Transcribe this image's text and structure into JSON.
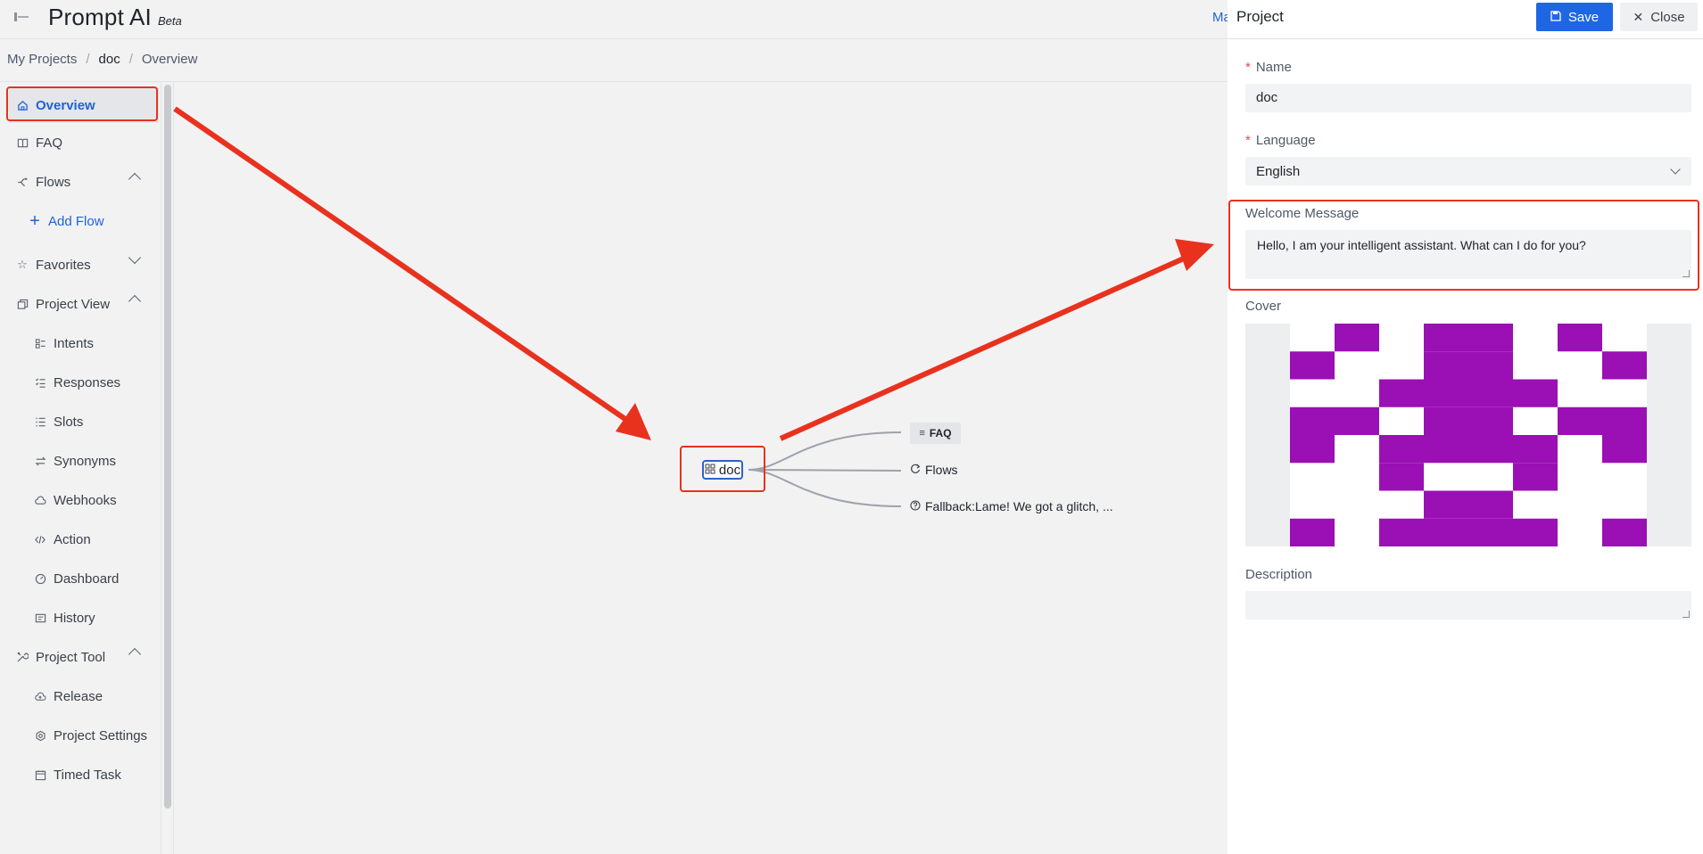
{
  "header": {
    "app_title": "Prompt AI",
    "app_badge": "Beta",
    "top_link": "Ma"
  },
  "breadcrumb": {
    "items": [
      "My Projects",
      "doc",
      "Overview"
    ],
    "separator": "/"
  },
  "sidebar": {
    "items": [
      {
        "label": "Overview",
        "icon": "home-icon",
        "active": true
      },
      {
        "label": "FAQ",
        "icon": "book-icon"
      },
      {
        "label": "Flows",
        "icon": "flow-icon",
        "expanded": true
      },
      {
        "label": "Add Flow",
        "icon": "plus-icon"
      },
      {
        "label": "Favorites",
        "icon": "star-icon",
        "expanded": false
      },
      {
        "label": "Project View",
        "icon": "project-view-icon",
        "expanded": true
      },
      {
        "label": "Intents",
        "icon": "intents-icon"
      },
      {
        "label": "Responses",
        "icon": "responses-icon"
      },
      {
        "label": "Slots",
        "icon": "slots-icon"
      },
      {
        "label": "Synonyms",
        "icon": "synonyms-icon"
      },
      {
        "label": "Webhooks",
        "icon": "cloud-icon"
      },
      {
        "label": "Action",
        "icon": "code-icon"
      },
      {
        "label": "Dashboard",
        "icon": "dashboard-icon"
      },
      {
        "label": "History",
        "icon": "history-icon"
      },
      {
        "label": "Project Tool",
        "icon": "tools-icon",
        "expanded": true
      },
      {
        "label": "Release",
        "icon": "release-icon"
      },
      {
        "label": "Project Settings",
        "icon": "settings-icon"
      },
      {
        "label": "Timed Task",
        "icon": "timed-task-icon"
      }
    ]
  },
  "canvas": {
    "root": {
      "label": "doc",
      "icon": "grid-icon"
    },
    "children": [
      {
        "label": "FAQ",
        "icon": "list-icon"
      },
      {
        "label": "Flows",
        "icon": "flow-icon"
      },
      {
        "label": "Fallback:Lame! We got a glitch, ...",
        "icon": "question-icon"
      }
    ]
  },
  "panel": {
    "title": "Project",
    "save_label": "Save",
    "close_label": "Close",
    "fields": {
      "name_label": "Name",
      "name_value": "doc",
      "language_label": "Language",
      "language_value": "English",
      "welcome_label": "Welcome Message",
      "welcome_value": "Hello, I am your intelligent assistant. What can I do for you?",
      "cover_label": "Cover",
      "description_label": "Description",
      "description_value": ""
    },
    "cover_color": "#9a10b4"
  },
  "colors": {
    "accent": "#1f66e5",
    "highlight": "#e8321e",
    "cover": "#9a10b4"
  }
}
